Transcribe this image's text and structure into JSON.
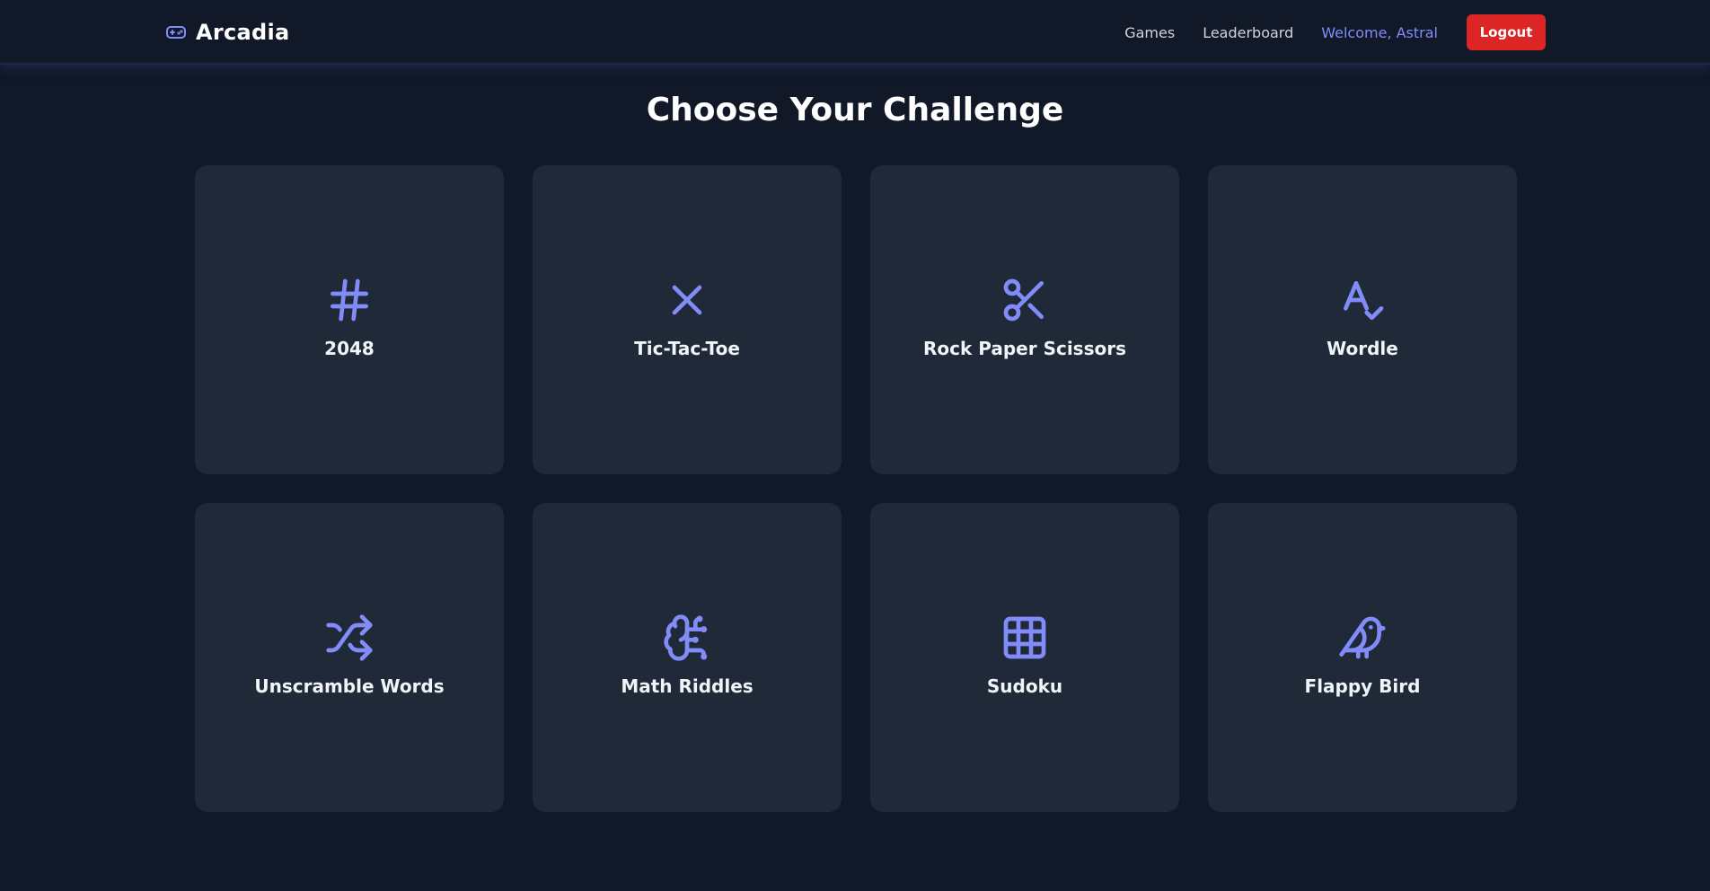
{
  "header": {
    "brand_name": "Arcadia",
    "brand_icon": "gamepad-icon",
    "nav_games": "Games",
    "nav_leaderboard": "Leaderboard",
    "welcome": "Welcome, Astral",
    "logout_label": "Logout"
  },
  "main": {
    "title": "Choose Your Challenge",
    "games": [
      {
        "label": "2048",
        "icon": "hash-icon"
      },
      {
        "label": "Tic-Tac-Toe",
        "icon": "x-icon"
      },
      {
        "label": "Rock Paper Scissors",
        "icon": "scissors-icon"
      },
      {
        "label": "Wordle",
        "icon": "spell-check-icon"
      },
      {
        "label": "Unscramble Words",
        "icon": "shuffle-icon"
      },
      {
        "label": "Math Riddles",
        "icon": "brain-icon"
      },
      {
        "label": "Sudoku",
        "icon": "grid-icon"
      },
      {
        "label": "Flappy Bird",
        "icon": "bird-icon"
      }
    ]
  },
  "colors": {
    "background": "#111827",
    "card": "#1f2937",
    "accent": "#818cf8",
    "logout": "#dc2626"
  }
}
